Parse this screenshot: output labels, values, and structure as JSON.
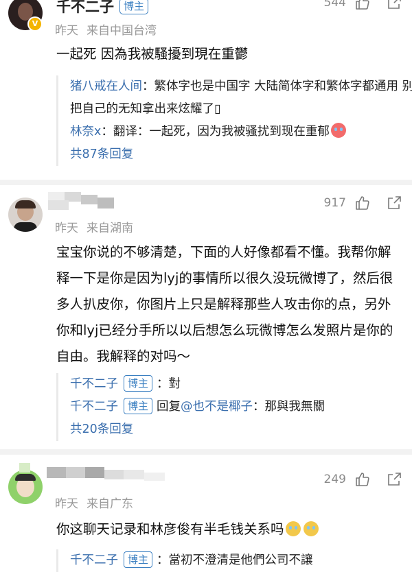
{
  "comments": [
    {
      "username": "千不二子",
      "badge": "博主",
      "time": "昨天",
      "location": "来自中国台湾",
      "like_count": "544",
      "text": "一起死 因為我被騷擾到現在重鬱",
      "replies": [
        {
          "name": "猪八戒在人间",
          "sep": "：",
          "text": "繁体字也是中国字 大陆简体字和繁体字都通用 别把自己的无知拿出来炫耀了▯"
        },
        {
          "name": "林奈x",
          "sep": "：",
          "text": "翻译：一起死，因为我被骚扰到现在重郁"
        }
      ],
      "total_replies": "共87条回复"
    },
    {
      "username": "",
      "time": "昨天",
      "location": "来自湖南",
      "like_count": "917",
      "text": "宝宝你说的不够清楚，下面的人好像都看不懂。我帮你解释一下是你是因为lyj的事情所以很久没玩微博了，然后很多人扒皮你，你图片上只是解释那些人攻击你的点，另外你和lyj已经分手所以以后想怎么玩微博怎么发照片是你的自由。我解释的对吗～",
      "replies": [
        {
          "name": "千不二子",
          "badge": "博主",
          "sep": "：",
          "text": "對"
        },
        {
          "name": "千不二子",
          "badge": "博主",
          "reply_word": "回复",
          "mention": "@也不是椰子",
          "sep": "：",
          "text": "那與我無關"
        }
      ],
      "total_replies": "共20条回复"
    },
    {
      "username": "",
      "time": "昨天",
      "location": "来自广东",
      "like_count": "249",
      "text": "你这聊天记录和林彦俊有半毛钱关系吗",
      "replies": [
        {
          "name": "千不二子",
          "badge": "博主",
          "sep": "：",
          "text": "當初不澄清是他們公司不讓"
        }
      ]
    }
  ],
  "icons": {
    "like": "thumbs-up-icon",
    "share": "share-icon",
    "verified": "verified-badge-icon",
    "emoji": "laugh-cry-emoji-icon"
  },
  "colors": {
    "link": "#3b6fae",
    "badge": "#3a7fc1",
    "meta": "#9a9a9a",
    "divider": "#f2f2f2"
  }
}
